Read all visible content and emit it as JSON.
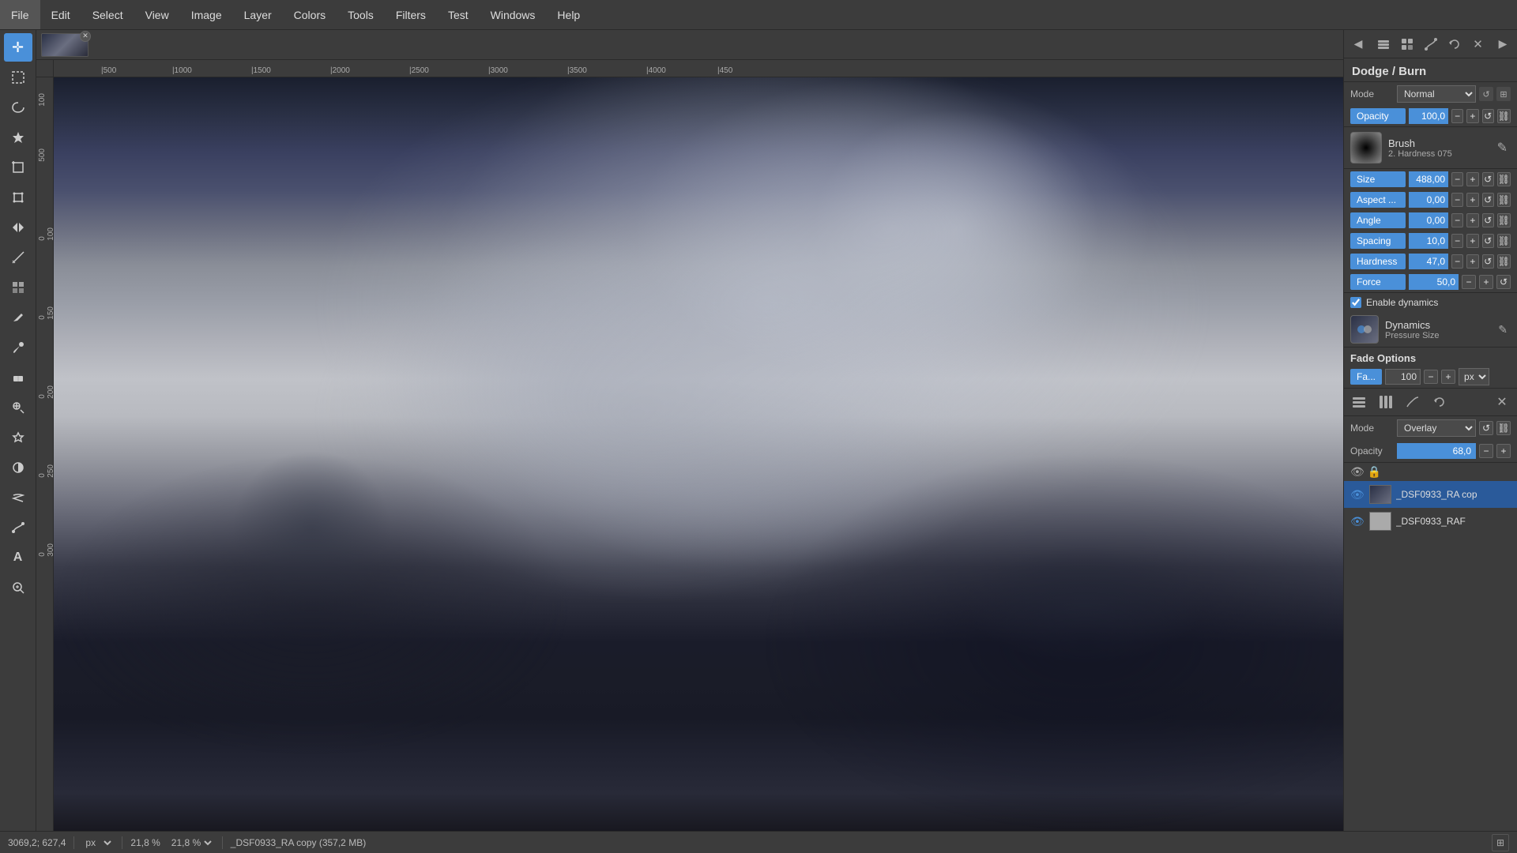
{
  "menubar": {
    "items": [
      "File",
      "Edit",
      "Select",
      "View",
      "Image",
      "Layer",
      "Colors",
      "Tools",
      "Filters",
      "Test",
      "Windows",
      "Help"
    ]
  },
  "thumbnail_strip": {
    "thumb_label": "cloud image thumbnail"
  },
  "toolbox": {
    "tools": [
      {
        "name": "move-tool",
        "icon": "✛"
      },
      {
        "name": "rect-select-tool",
        "icon": "⬚"
      },
      {
        "name": "lasso-tool",
        "icon": "⭔"
      },
      {
        "name": "fuzzy-select-tool",
        "icon": "⬡"
      },
      {
        "name": "crop-tool",
        "icon": "⬣"
      },
      {
        "name": "transform-tool",
        "icon": "⬥"
      },
      {
        "name": "flip-tool",
        "icon": "⇔"
      },
      {
        "name": "paint-bucket-tool",
        "icon": "🪣"
      },
      {
        "name": "blend-tool",
        "icon": "▦"
      },
      {
        "name": "pencil-tool",
        "icon": "✏"
      },
      {
        "name": "paintbrush-tool",
        "icon": "🖌"
      },
      {
        "name": "eraser-tool",
        "icon": "⬜"
      },
      {
        "name": "clone-tool",
        "icon": "⊕"
      },
      {
        "name": "heal-tool",
        "icon": "⊞"
      },
      {
        "name": "dodge-burn-tool",
        "icon": "◑",
        "active": true
      },
      {
        "name": "smudge-tool",
        "icon": "〜"
      },
      {
        "name": "path-tool",
        "icon": "∿"
      },
      {
        "name": "text-tool",
        "icon": "A"
      },
      {
        "name": "zoom-tool",
        "icon": "⊕"
      }
    ]
  },
  "ruler": {
    "h_marks": [
      "500",
      "1000",
      "1500",
      "2000",
      "2500",
      "3000",
      "3500",
      "4000",
      "450"
    ],
    "v_marks": [
      "100",
      "500",
      "1000",
      "1500",
      "2000",
      "2500",
      "3000"
    ]
  },
  "right_panel": {
    "tool_title": "Dodge / Burn",
    "mode_label": "Mode",
    "mode_value": "Normal",
    "opacity_label": "Opacity",
    "opacity_value": "100,0",
    "brush": {
      "name": "Brush",
      "subtitle": "2. Hardness 075"
    },
    "size_label": "Size",
    "size_value": "488,00",
    "aspect_label": "Aspect ...",
    "aspect_value": "0,00",
    "angle_label": "Angle",
    "angle_value": "0,00",
    "spacing_label": "Spacing",
    "spacing_value": "10,0",
    "hardness_label": "Hardness",
    "hardness_value": "47,0",
    "force_label": "Force",
    "force_value": "50,0",
    "enable_dynamics_label": "Enable dynamics",
    "dynamics": {
      "name": "Dynamics",
      "subtitle": "Pressure Size"
    },
    "fade_options": {
      "title": "Fade Options",
      "fade_label": "Fa...",
      "fade_value": "100",
      "fade_unit": "px"
    },
    "layers_mode_label": "Mode",
    "layers_mode_value": "Overlay",
    "layers_opacity_label": "Opacity",
    "layers_opacity_value": "68,0",
    "layers": [
      {
        "name": "_DSF0933_RA cop",
        "active": true,
        "visible": true
      },
      {
        "name": "_DSF0933_RAF",
        "active": false,
        "visible": true
      }
    ]
  },
  "statusbar": {
    "coordinates": "3069,2; 627,4",
    "unit": "px",
    "zoom": "21,8 %",
    "filename": "_DSF0933_RA copy (357,2 MB)"
  }
}
